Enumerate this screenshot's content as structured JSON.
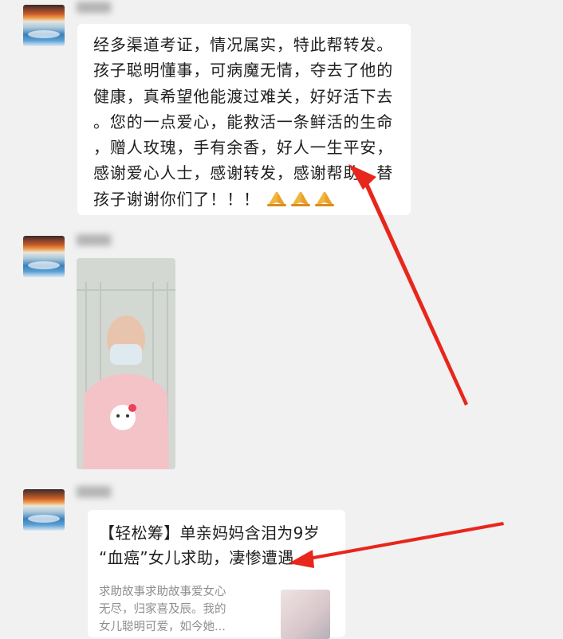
{
  "messages": [
    {
      "type": "text",
      "lines": [
        "经多渠道考证，情况属实，特此帮转发。",
        "孩子聪明懂事，可病魔无情，夺去了他的",
        "健康，真希望他能渡过难关，好好活下去",
        "。您的一点爱心，能救活一条鲜活的生命",
        "，赠人玫瑰，手有余香，好人一生平安，",
        "感谢爱心人士，感谢转发，感谢帮助，替",
        "孩子谢谢你们了！！！"
      ],
      "emoji_icons": [
        "pray-hands-icon",
        "pray-hands-icon",
        "pray-hands-icon"
      ]
    },
    {
      "type": "image"
    },
    {
      "type": "link-card",
      "title_line1": "【轻松筹】单亲妈妈含泪为9岁",
      "title_line2": "“血癌”女儿求助，凄惨遭遇...",
      "desc_lines": [
        "求助故事求助故事爱女心",
        "无尽，归家喜及辰。我的",
        "女儿聪明可爱，如今她..."
      ]
    }
  ],
  "colors": {
    "background": "#f1f1f1",
    "bubble": "#ffffff",
    "annotation_arrow": "#e8261c"
  }
}
